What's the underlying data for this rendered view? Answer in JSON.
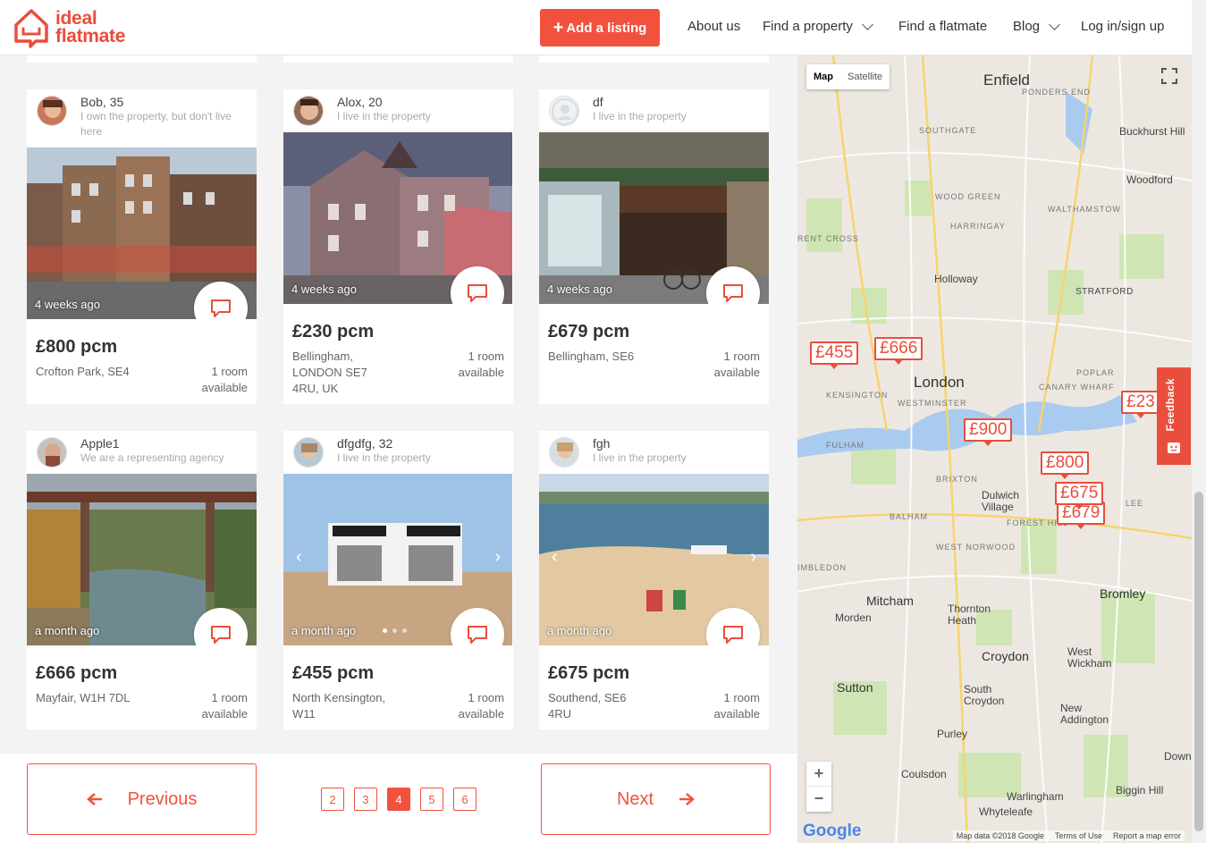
{
  "header": {
    "logo_line1": "ideal",
    "logo_line2": "flatmate",
    "add_listing": "Add a listing",
    "nav": {
      "about": "About us",
      "find_property": "Find a property",
      "find_flatmate": "Find a flatmate",
      "blog": "Blog",
      "login": "Log in/sign up"
    }
  },
  "listings": [
    {
      "user": "Bob, 35",
      "desc": "I own the property, but don't live here",
      "ago": "4 weeks ago",
      "price": "£800 pcm",
      "location": "Crofton Park, SE4",
      "rooms": "1 room available"
    },
    {
      "user": "Alox, 20",
      "desc": "I live in the property",
      "ago": "4 weeks ago",
      "price": "£230 pcm",
      "location": "Bellingham, LONDON SE7 4RU, UK",
      "rooms": "1 room available"
    },
    {
      "user": "df",
      "desc": "I live in the property",
      "ago": "4 weeks ago",
      "price": "£679 pcm",
      "location": "Bellingham, SE6",
      "rooms": "1 room available"
    },
    {
      "user": "Apple1",
      "desc": "We are a representing agency",
      "ago": "a month ago",
      "price": "£666 pcm",
      "location": "Mayfair, W1H 7DL",
      "rooms": "1 room available"
    },
    {
      "user": "dfgdfg, 32",
      "desc": "I live in the property",
      "ago": "a month ago",
      "price": "£455 pcm",
      "location": "North Kensington, W11",
      "rooms": "1 room available"
    },
    {
      "user": "fgh",
      "desc": "I live in the property",
      "ago": "a month ago",
      "price": "£675 pcm",
      "location": "Southend, SE6 4RU",
      "rooms": "1 room available"
    }
  ],
  "pagination": {
    "previous": "Previous",
    "next": "Next",
    "pages": [
      "2",
      "3",
      "4",
      "5",
      "6"
    ],
    "current": "4"
  },
  "map": {
    "toggle_map": "Map",
    "toggle_satellite": "Satellite",
    "pins": [
      "£455",
      "£666",
      "£900",
      "£800",
      "£675",
      "£679",
      "£23"
    ],
    "labels": [
      "Enfield",
      "London",
      "Holloway",
      "STRATFORD",
      "Woodford",
      "Buckhurst Hill",
      "Mitcham",
      "Morden",
      "Croydon",
      "Sutton",
      "Bromley",
      "Dulwich Village",
      "Thornton Heath",
      "South Croydon",
      "Purley",
      "Coulsdon",
      "West Wickham",
      "New Addington",
      "Biggin Hill",
      "Warlingham",
      "Whyteleafe",
      "Down"
    ],
    "small_labels": [
      "PONDERS END",
      "SOUTHGATE",
      "WOOD GREEN",
      "HARRINGAY",
      "WALTHAMSTOW",
      "KENSINGTON",
      "WESTMINSTER",
      "CANARY WHARF",
      "POPLAR",
      "FULHAM",
      "BRIXTON",
      "BALHAM",
      "FOREST HILL",
      "WEST NORWOOD",
      "LEE",
      "RENT CROSS",
      "IMBLEDON"
    ],
    "zoom_in": "+",
    "zoom_out": "−",
    "attribution": [
      "Map data ©2018 Google",
      "Terms of Use",
      "Report a map error"
    ],
    "google": "Google"
  },
  "feedback": "Feedback"
}
